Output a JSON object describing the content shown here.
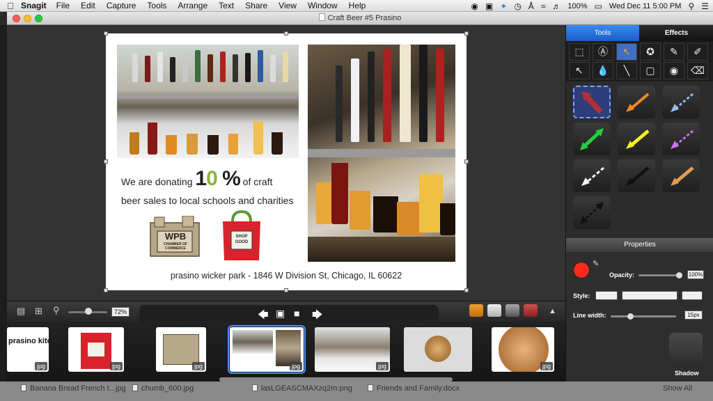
{
  "menubar": {
    "app_name": "Snagit",
    "items": [
      "File",
      "Edit",
      "Capture",
      "Tools",
      "Arrange",
      "Text",
      "Share",
      "View",
      "Window",
      "Help"
    ],
    "battery": "100%",
    "clock": "Wed Dec 11  5:00 PM"
  },
  "window": {
    "title": "Craft Beer #5 Prasino"
  },
  "flyer": {
    "donate_prefix": "We are donating",
    "donate_pct_one": "1",
    "donate_pct_zero": "0",
    "donate_pct_sign": " %",
    "donate_suffix": "of craft",
    "donate_line2": "beer sales to local schools and charities",
    "wpb_text": "WPB",
    "wpb_sub": "CHAMBER OF COMMERCE",
    "bag_text": "SHOP GOOD",
    "address": "prasino wicker park - 1846 W Division St, Chicago, IL 60622"
  },
  "toolbar": {
    "zoom_value": "72%"
  },
  "tray": {
    "thumbs": [
      {
        "label": "prasino kitchen",
        "badge": "jpg"
      },
      {
        "label": "shop good",
        "badge": "jpg"
      },
      {
        "label": "wpb chamber",
        "badge": "jpg"
      },
      {
        "label": "craft beer 5",
        "badge": "jpg"
      },
      {
        "label": "beer taps",
        "badge": "jpg"
      },
      {
        "label": "shield swords",
        "badge": ""
      },
      {
        "label": "shield",
        "badge": "jpg"
      }
    ]
  },
  "panel": {
    "tab_tools": "Tools",
    "tab_effects": "Effects",
    "properties_title": "Properties",
    "opacity_label": "Opacity:",
    "opacity_value": "100%",
    "style_label": "Style:",
    "line_width_label": "Line width:",
    "line_width_value": "15px",
    "shadow_label": "Shadow",
    "color_swatch": "#ff2a1a",
    "accent": "#1f6fd6"
  },
  "finder": {
    "items": [
      "Banana Bread French t...jpg",
      "chumb_600.jpg",
      "lasLGEASCMAXzq2m.png",
      "Friends and Family.docx"
    ],
    "show_all": "Show All"
  }
}
